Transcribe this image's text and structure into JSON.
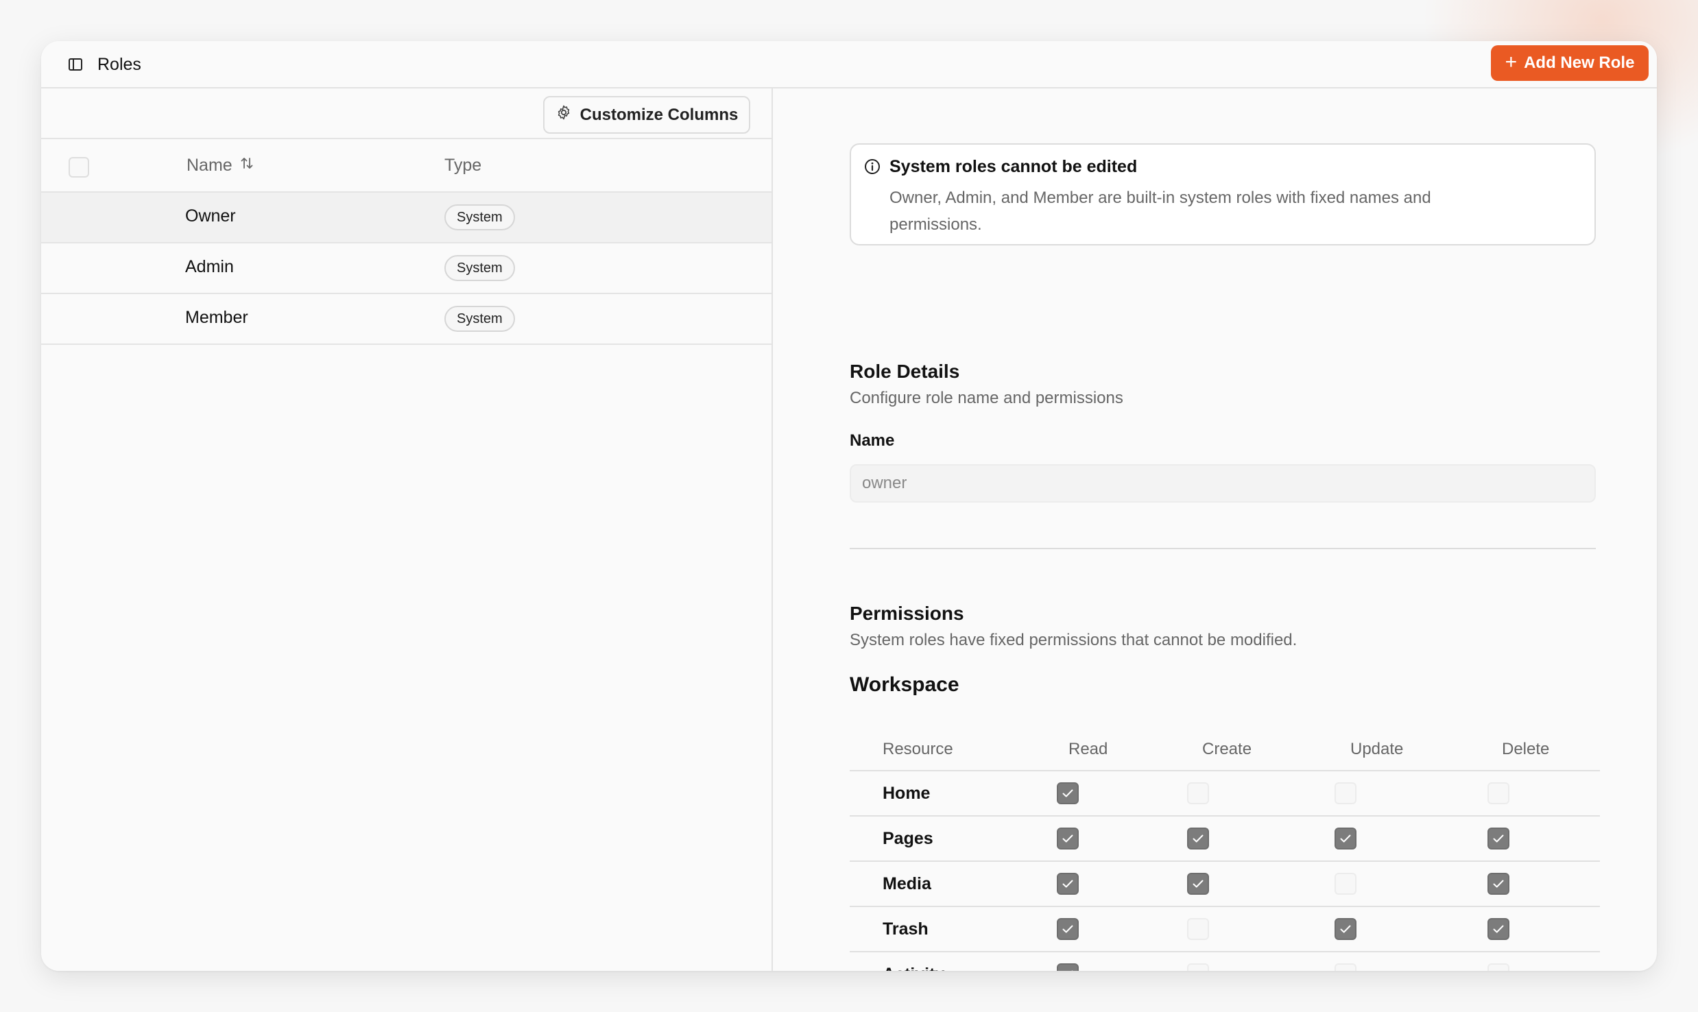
{
  "header": {
    "title": "Roles",
    "add_button_label": "Add New Role"
  },
  "roles_table": {
    "customize_label": "Customize Columns",
    "columns": {
      "name": "Name",
      "type": "Type"
    },
    "rows": [
      {
        "name": "Owner",
        "type": "System",
        "selected": true
      },
      {
        "name": "Admin",
        "type": "System",
        "selected": false
      },
      {
        "name": "Member",
        "type": "System",
        "selected": false
      }
    ]
  },
  "alert": {
    "title": "System roles cannot be edited",
    "body": "Owner, Admin, and Member are built-in system roles with fixed names and permissions."
  },
  "role_details": {
    "title": "Role Details",
    "subtitle": "Configure role name and permissions",
    "name_label": "Name",
    "name_value": "owner"
  },
  "permissions": {
    "title": "Permissions",
    "subtitle": "System roles have fixed permissions that cannot be modified.",
    "group": "Workspace",
    "columns": [
      "Resource",
      "Read",
      "Create",
      "Update",
      "Delete"
    ],
    "rows": [
      {
        "resource": "Home",
        "read": true,
        "create": false,
        "update": false,
        "delete": false
      },
      {
        "resource": "Pages",
        "read": true,
        "create": true,
        "update": true,
        "delete": true
      },
      {
        "resource": "Media",
        "read": true,
        "create": true,
        "update": false,
        "delete": true
      },
      {
        "resource": "Trash",
        "read": true,
        "create": false,
        "update": true,
        "delete": true
      },
      {
        "resource": "Activity",
        "read": true,
        "create": false,
        "update": false,
        "delete": false
      }
    ]
  },
  "colors": {
    "accent": "#ea5a23",
    "checkbox_checked": "#7c7c7c"
  }
}
